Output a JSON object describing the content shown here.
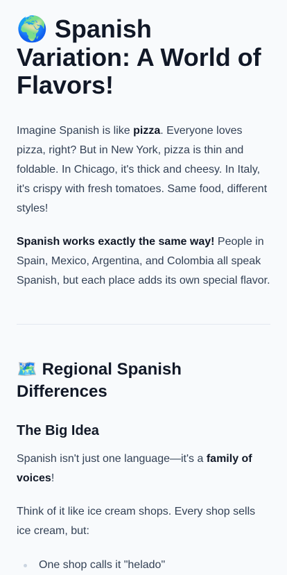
{
  "article": {
    "title_emoji": "🌍",
    "title_text": "Spanish Variation: A World of Flavors!",
    "intro": {
      "p1_a": "Imagine Spanish is like ",
      "p1_bold": "pizza",
      "p1_b": ". Everyone loves pizza, right? But in New York, pizza is thin and foldable. In Chicago, it's thick and cheesy. In Italy, it's crispy with fresh tomatoes. Same food, different styles!",
      "p2_bold": "Spanish works exactly the same way!",
      "p2_rest": " People in Spain, Mexico, Argentina, and Colombia all speak Spanish, but each place adds its own special flavor."
    },
    "section": {
      "emoji": "🗺️",
      "heading": "Regional Spanish Differences",
      "subheading": "The Big Idea",
      "p3_a": "Spanish isn't just one language—it's a ",
      "p3_bold": "family of voices",
      "p3_b": "!",
      "p4": "Think of it like ice cream shops. Every shop sells ice cream, but:",
      "list": [
        "One shop calls it \"helado\""
      ]
    }
  }
}
